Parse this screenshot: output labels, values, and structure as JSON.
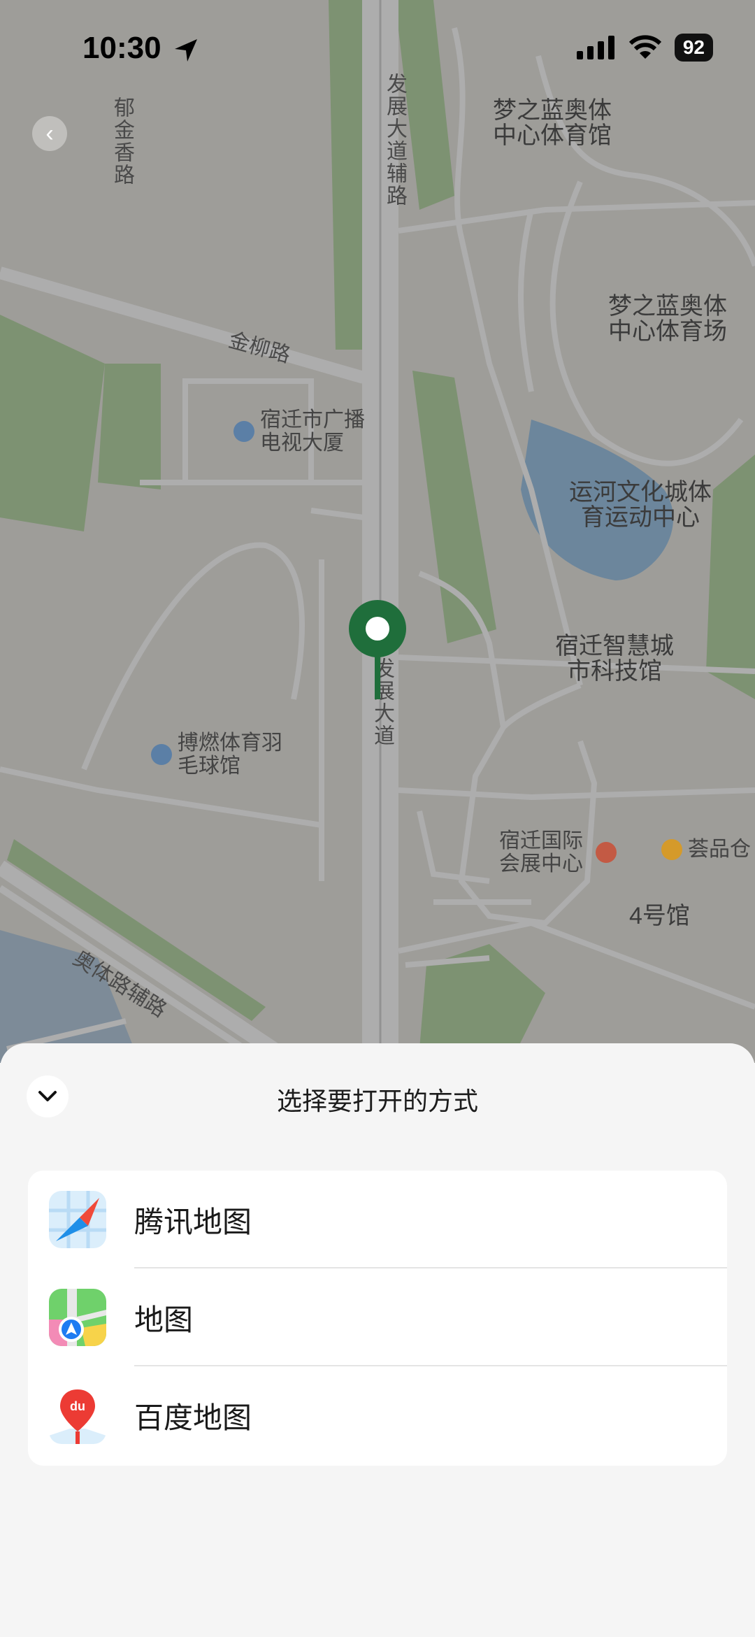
{
  "status_bar": {
    "time": "10:30",
    "battery": "92"
  },
  "map": {
    "labels": {
      "yujinxiang_road": "郁金香路",
      "fazhan_aux_road": "发展大道辅路",
      "mengzhilan_gym": "梦之蓝奥体中心体育馆",
      "mengzhilan_stadium": "梦之蓝奥体中心体育场",
      "jinliu_road": "金柳路",
      "suqian_tv": "宿迁市广播电视大厦",
      "yunhe_center": "运河文化城体育运动中心",
      "zhihui_building": "宿迁智慧城市科技馆",
      "fazhan_road": "发展大道",
      "boran_gym": "搏燃体育羽毛球馆",
      "expo_center": "宿迁国际会展中心",
      "huicang": "荟品仓",
      "hall4": "4号馆",
      "aoti_aux_road": "奥体路辅路"
    }
  },
  "sheet": {
    "title": "选择要打开的方式",
    "options": [
      {
        "label": "腾讯地图",
        "icon": "tencent-map-icon"
      },
      {
        "label": "地图",
        "icon": "apple-maps-icon"
      },
      {
        "label": "百度地图",
        "icon": "baidu-map-icon"
      }
    ],
    "baidu_logo_text": "du"
  }
}
